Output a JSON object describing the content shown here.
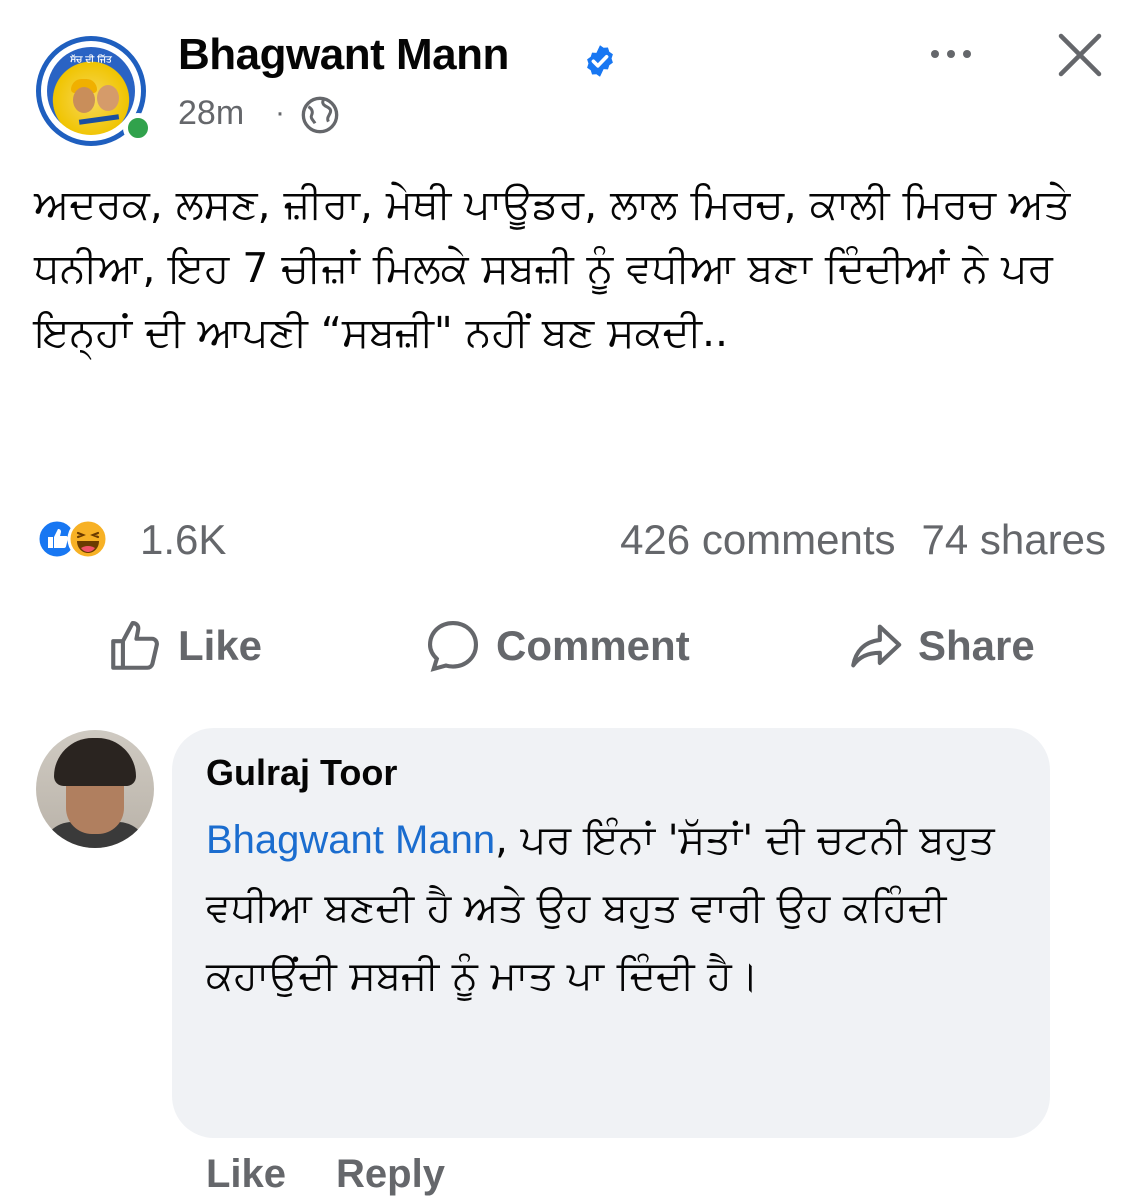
{
  "post": {
    "author_name": "Bhagwant Mann",
    "avatar_banner": "ਸੱਚ ਦੀ ਜਿੱਤ",
    "timestamp": "28m",
    "separator": "·",
    "more_label": "...",
    "text": "ਅਦਰਕ, ਲਸਣ, ਜ਼ੀਰਾ, ਮੇਥੀ ਪਾਊਡਰ, ਲਾਲ ਮਿਰਚ, ਕਾਲੀ ਮਿਰਚ ਅਤੇ ਧਨੀਆ, ਇਹ 7 ਚੀਜ਼ਾਂ ਮਿਲਕੇ ਸਬਜ਼ੀ ਨੂੰ ਵਧੀਆ ਬਣਾ ਦਿੰਦੀਆਂ ਨੇ ਪਰ ਇਨ੍ਹਾਂ ਦੀ ਆਪਣੀ “ਸਬਜ਼ੀ\" ਨਹੀਂ ਬਣ ਸਕਦੀ.."
  },
  "stats": {
    "reactions_count": "1.6K",
    "comments": "426 comments",
    "shares": "74 shares"
  },
  "actions": {
    "like": "Like",
    "comment": "Comment",
    "share": "Share"
  },
  "comment": {
    "author_name": "Gulraj Toor",
    "mention": "Bhagwant Mann",
    "text": ", ਪਰ ਇੰਨਾਂ 'ਸੱਤਾਂ' ਦੀ ਚਟਨੀ ਬਹੁਤ ਵਧੀਆ ਬਣਦੀ ਹੈ ਅਤੇ ਉਹ ਬਹੁਤ ਵਾਰੀ ਉਹ ਕਹਿੰਦੀ ਕਹਾਉਂਦੀ ਸਬਜੀ ਨੂੰ ਮਾਤ ਪਾ ਦਿੰਦੀ ਹੈ।",
    "like_label": "Like",
    "reply_label": "Reply"
  },
  "colors": {
    "mention_blue": "#1b6dcf",
    "secondary_text": "#65676b",
    "bubble_bg": "#f0f2f5",
    "online_green": "#31a24c",
    "verified_blue": "#1877f2"
  }
}
